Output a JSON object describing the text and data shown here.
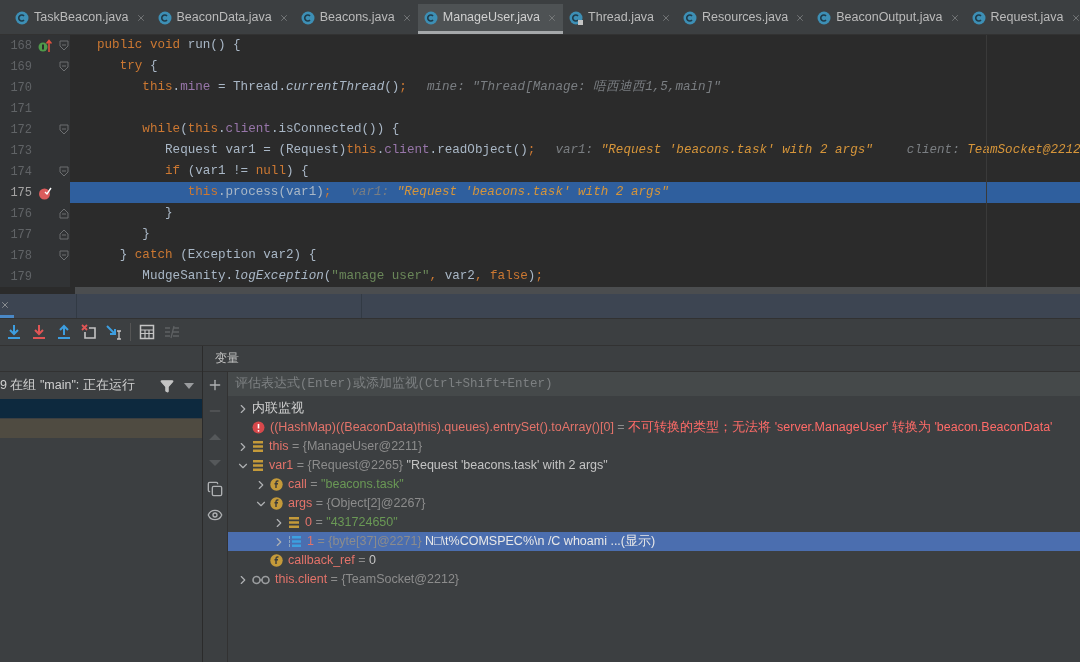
{
  "tabs": [
    {
      "label": "TaskBeacon.java",
      "selected": false,
      "locked": false
    },
    {
      "label": "BeaconData.java",
      "selected": false,
      "locked": false
    },
    {
      "label": "Beacons.java",
      "selected": false,
      "locked": false
    },
    {
      "label": "ManageUser.java",
      "selected": true,
      "locked": false
    },
    {
      "label": "Thread.java",
      "selected": false,
      "locked": true
    },
    {
      "label": "Resources.java",
      "selected": false,
      "locked": false
    },
    {
      "label": "BeaconOutput.java",
      "selected": false,
      "locked": false
    },
    {
      "label": "Request.java",
      "selected": false,
      "locked": false
    }
  ],
  "editor": {
    "lines": [
      {
        "number": "168",
        "highlighted": false,
        "marker": {
          "kind": "implements"
        },
        "fold": {
          "kind": "start"
        },
        "code": [
          {
            "kind": "kw",
            "text": "public void"
          },
          {
            "kind": "plain",
            "text": " run() {"
          }
        ]
      },
      {
        "number": "169",
        "highlighted": false,
        "fold": {
          "kind": "start"
        },
        "code": [
          {
            "kind": "kw",
            "text": "   try"
          },
          {
            "kind": "plain",
            "text": " {"
          }
        ]
      },
      {
        "number": "170",
        "highlighted": false,
        "code": [
          {
            "kind": "kw",
            "text": "      this"
          },
          {
            "kind": "plain",
            "text": "."
          },
          {
            "kind": "field",
            "text": "mine"
          },
          {
            "kind": "plain",
            "text": " = Thread."
          },
          {
            "kind": "static",
            "text": "currentThread"
          },
          {
            "kind": "plain",
            "text": "()"
          },
          {
            "kind": "kw",
            "text": ";"
          }
        ],
        "hints": [
          {
            "label": "mine:",
            "value": "\"Thread[Manage: 唔西迪西1,5,main]\"",
            "kind": "plain"
          }
        ]
      },
      {
        "number": "171",
        "highlighted": false
      },
      {
        "number": "172",
        "highlighted": false,
        "fold": {
          "kind": "start"
        },
        "code": [
          {
            "kind": "kw",
            "text": "      while"
          },
          {
            "kind": "plain",
            "text": "("
          },
          {
            "kind": "kw",
            "text": "this"
          },
          {
            "kind": "plain",
            "text": "."
          },
          {
            "kind": "field",
            "text": "client"
          },
          {
            "kind": "plain",
            "text": ".isConnected()) {"
          }
        ]
      },
      {
        "number": "173",
        "highlighted": false,
        "code": [
          {
            "kind": "plain",
            "text": "         Request var1 = (Request)"
          },
          {
            "kind": "kw",
            "text": "this"
          },
          {
            "kind": "plain",
            "text": "."
          },
          {
            "kind": "field",
            "text": "client"
          },
          {
            "kind": "plain",
            "text": ".readObject()"
          },
          {
            "kind": "kw",
            "text": ";"
          }
        ],
        "hints": [
          {
            "label": "var1:",
            "value": "\"Request 'beacons.task' with 2 args\"",
            "kind": "value"
          },
          {
            "label": "client:",
            "value": "TeamSocket@2212",
            "kind": "value"
          }
        ]
      },
      {
        "number": "174",
        "highlighted": false,
        "fold": {
          "kind": "start"
        },
        "code": [
          {
            "kind": "kw",
            "text": "         if"
          },
          {
            "kind": "plain",
            "text": " (var1 != "
          },
          {
            "kind": "kw",
            "text": "null"
          },
          {
            "kind": "plain",
            "text": ") {"
          }
        ]
      },
      {
        "number": "175",
        "highlighted": true,
        "marker": {
          "kind": "breakpoint"
        },
        "code": [
          {
            "kind": "kw",
            "text": "            this"
          },
          {
            "kind": "plain",
            "text": ".process(var1)"
          },
          {
            "kind": "kw",
            "text": ";"
          }
        ],
        "hints": [
          {
            "label": "var1:",
            "value": "\"Request 'beacons.task' with 2 args\"",
            "kind": "value"
          }
        ]
      },
      {
        "number": "176",
        "highlighted": false,
        "fold": {
          "kind": "end"
        },
        "code": [
          {
            "kind": "plain",
            "text": "         }"
          }
        ]
      },
      {
        "number": "177",
        "highlighted": false,
        "fold": {
          "kind": "end"
        },
        "code": [
          {
            "kind": "plain",
            "text": "      }"
          }
        ]
      },
      {
        "number": "178",
        "highlighted": false,
        "fold": {
          "kind": "start"
        },
        "code": [
          {
            "kind": "plain",
            "text": "   } "
          },
          {
            "kind": "kw",
            "text": "catch"
          },
          {
            "kind": "plain",
            "text": " (Exception var2) {"
          }
        ]
      },
      {
        "number": "179",
        "highlighted": false,
        "code": [
          {
            "kind": "plain",
            "text": "      MudgeSanity."
          },
          {
            "kind": "static",
            "text": "logException"
          },
          {
            "kind": "plain",
            "text": "("
          },
          {
            "kind": "str",
            "text": "\"manage user\""
          },
          {
            "kind": "kw",
            "text": ","
          },
          {
            "kind": "plain",
            "text": " var2"
          },
          {
            "kind": "kw",
            "text": ","
          },
          {
            "kind": "kw",
            "text": " false"
          },
          {
            "kind": "plain",
            "text": ")"
          },
          {
            "kind": "kw",
            "text": ";"
          }
        ]
      }
    ]
  },
  "debugger": {
    "toolbar": [
      {
        "kind": "step-over",
        "disabled": false
      },
      {
        "kind": "force-step-into",
        "disabled": false
      },
      {
        "kind": "step-out",
        "disabled": false
      },
      {
        "kind": "drop-frame",
        "disabled": false
      },
      {
        "kind": "run-to-cursor",
        "disabled": false
      },
      {
        "kind": "separator"
      },
      {
        "kind": "evaluate",
        "disabled": false
      },
      {
        "kind": "trace",
        "disabled": true
      }
    ],
    "threads": {
      "label": "9 在组 \"main\": 正在运行"
    },
    "frames": [
      {
        "color": "#0d293e"
      },
      {
        "color": "#4f4b41"
      }
    ],
    "variables": {
      "title": "变量",
      "placeholder": "评估表达式(Enter)或添加监视(Ctrl+Shift+Enter)",
      "side_tools": [
        {
          "kind": "add",
          "disabled": false
        },
        {
          "kind": "remove",
          "disabled": true
        },
        {
          "kind": "up",
          "disabled": true
        },
        {
          "kind": "down",
          "disabled": true
        },
        {
          "kind": "copy",
          "disabled": false
        },
        {
          "kind": "view",
          "disabled": false
        }
      ],
      "tree": [
        {
          "kind": "group",
          "name": "内联监视",
          "expanded": false,
          "selected": false
        },
        {
          "kind": "error",
          "name": "((HashMap)((BeaconData)this).queues).entrySet().toArray()[0]",
          "eq": "=",
          "value": "不可转换的类型；无法将 'server.ManageUser' 转换为 'beacon.BeaconData'",
          "selected": false
        },
        {
          "kind": "variable",
          "name": "this",
          "eq": "=",
          "ref": "{ManageUser@2211}",
          "expanded": false,
          "selected": false
        },
        {
          "kind": "variable",
          "name": "var1",
          "eq": "=",
          "ref": "{Request@2265}",
          "value": "\"Request 'beacons.task' with 2 args\"",
          "expanded": true,
          "selected": false,
          "children": [
            {
              "kind": "field",
              "name": "call",
              "eq": "=",
              "string": "\"beacons.task\"",
              "expanded": false,
              "selected": false
            },
            {
              "kind": "field",
              "name": "args",
              "eq": "=",
              "ref": "{Object[2]@2267}",
              "expanded": true,
              "selected": false,
              "children": [
                {
                  "kind": "variable",
                  "name": "0",
                  "eq": "=",
                  "string": "\"431724650\"",
                  "expanded": false,
                  "selected": false
                },
                {
                  "kind": "array",
                  "name": "1",
                  "eq": "=",
                  "ref": "{byte[37]@2271}",
                  "value": "N□\\t%COMSPEC%\\n /C whoami ...(显示)",
                  "expanded": false,
                  "selected": true
                }
              ]
            },
            {
              "kind": "field",
              "name": "callback_ref",
              "eq": "=",
              "value": "0",
              "selected": false
            }
          ]
        },
        {
          "kind": "watch",
          "name": "this.client",
          "eq": "=",
          "ref": "{TeamSocket@2212}",
          "expanded": false,
          "selected": false
        }
      ]
    }
  }
}
